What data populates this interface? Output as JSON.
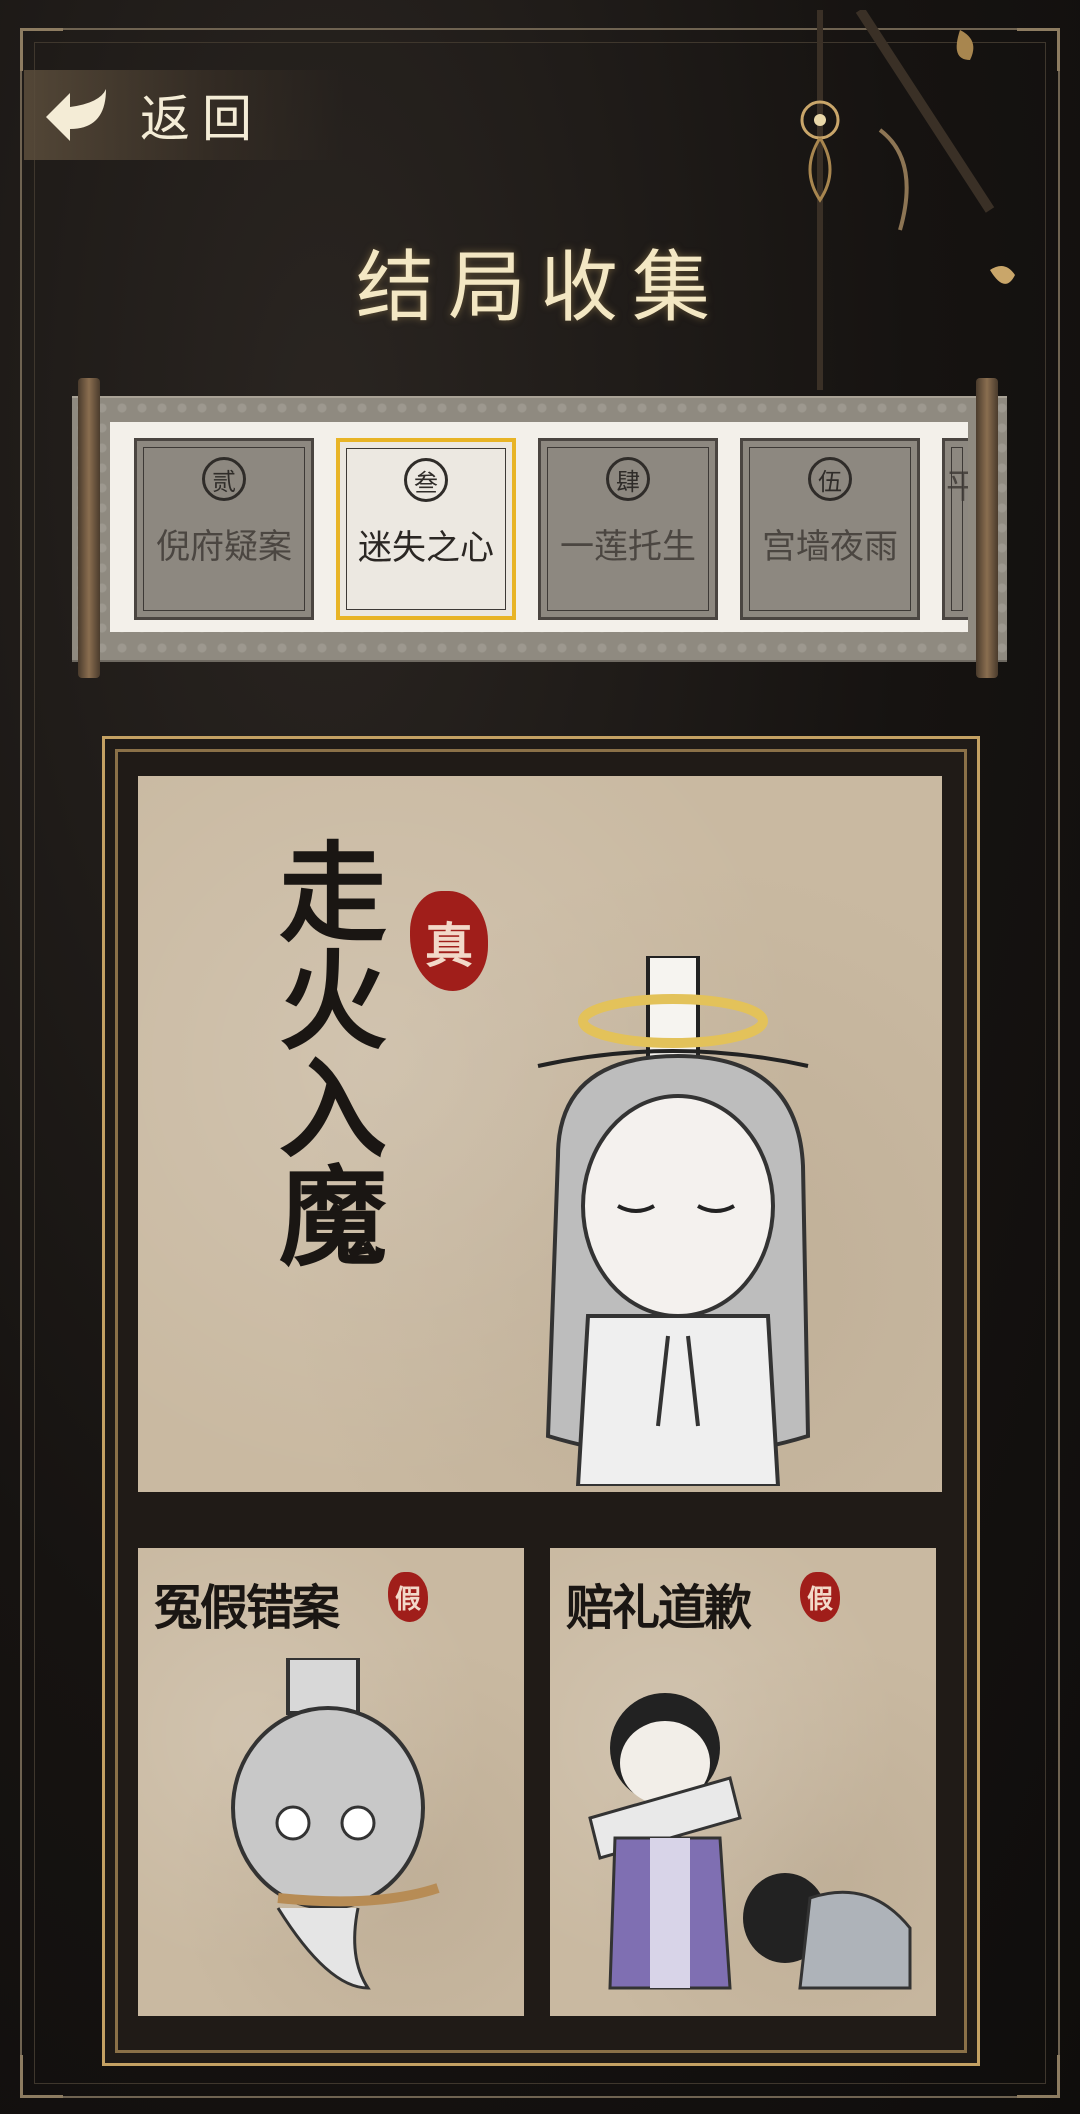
{
  "header": {
    "back_label": "返回",
    "title": "结局收集"
  },
  "endings_tabs": [
    {
      "num": "贰",
      "name": "倪府疑案",
      "active": false
    },
    {
      "num": "叁",
      "name": "迷失之心",
      "active": true
    },
    {
      "num": "肆",
      "name": "一莲托生",
      "active": false
    },
    {
      "num": "伍",
      "name": "宫墙夜雨",
      "active": false
    },
    {
      "num": "",
      "name": "平",
      "active": false
    }
  ],
  "main_ending": {
    "title": "走火入魔",
    "seal": "真"
  },
  "sub_endings": [
    {
      "title": "冤假错案",
      "seal": "假"
    },
    {
      "title": "赔礼道歉",
      "seal": "假"
    }
  ],
  "colors": {
    "gold_accent": "#e8b426",
    "seal_red": "#a01e1a",
    "paper": "#c9b9a1",
    "background": "#161311"
  }
}
